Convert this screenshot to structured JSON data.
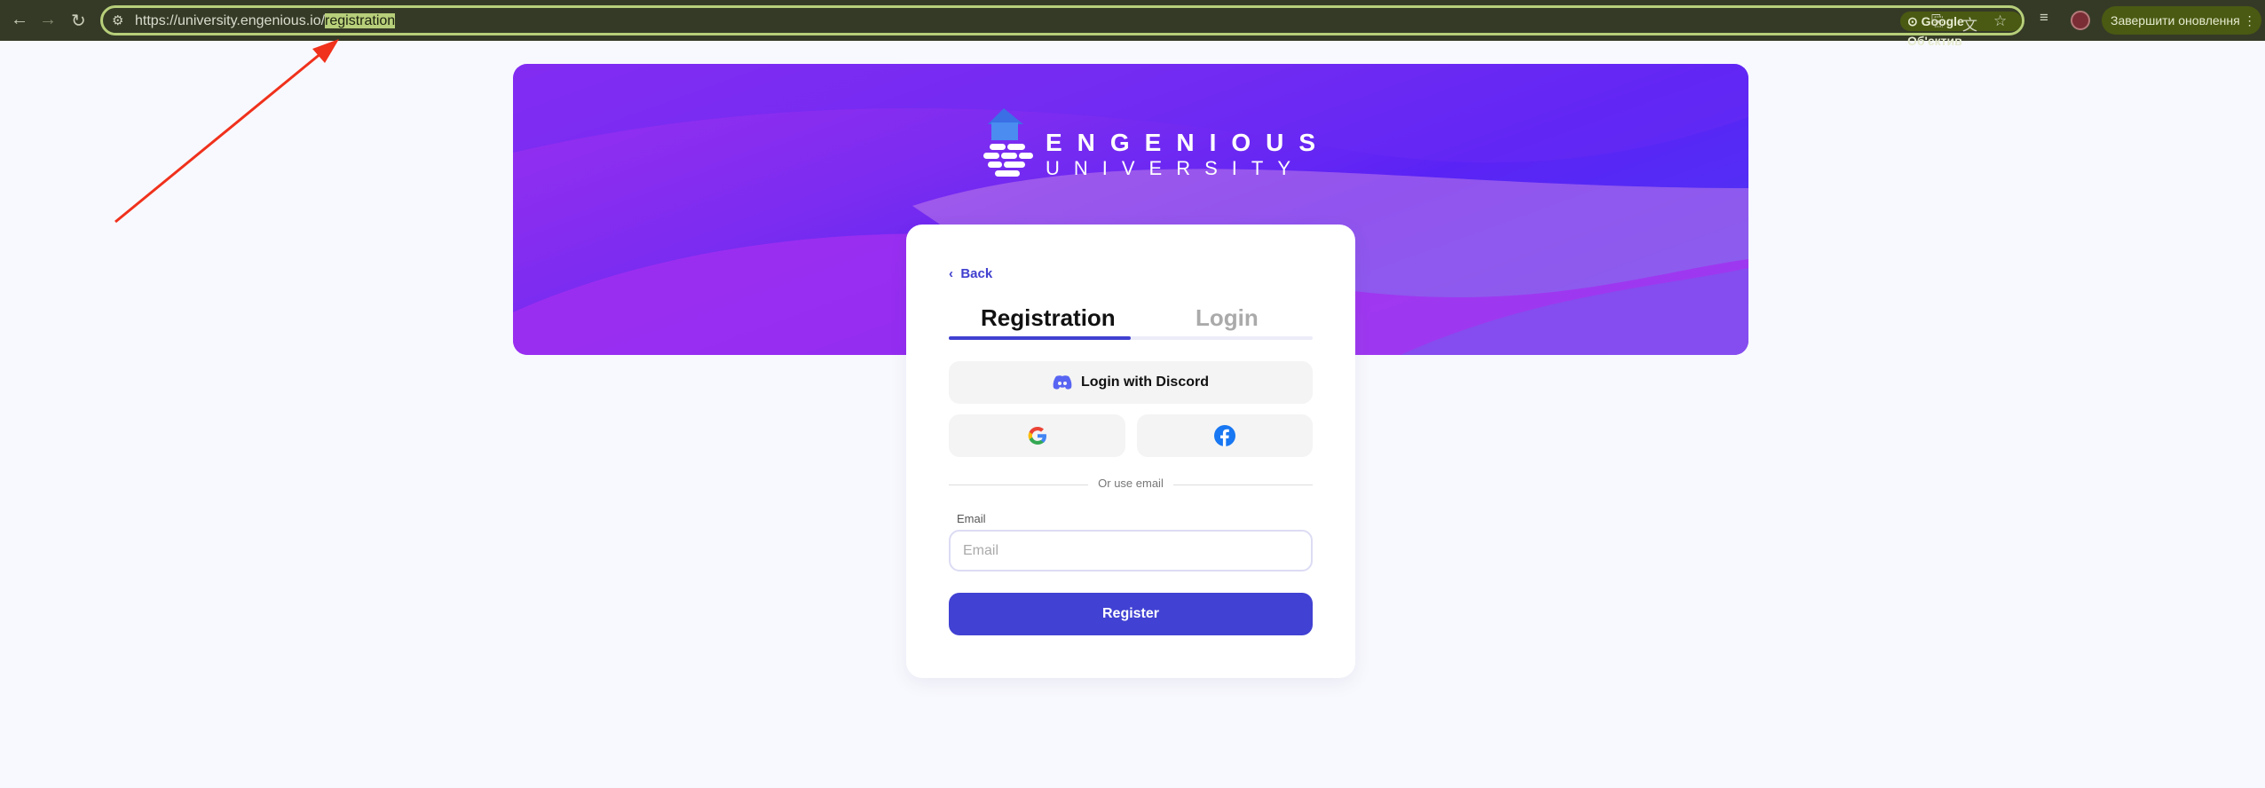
{
  "browser": {
    "url_base": "https://university.engenious.io/",
    "url_path": "registration",
    "lens_label": "Google Об'єктив",
    "update_label": "Завершити оновлення"
  },
  "banner": {
    "brand_line1": "ENGENIOUS",
    "brand_line2": "UNIVERSITY",
    "gradient_colors": [
      "#9c2ff0",
      "#5a23f5",
      "#4a3cf5"
    ]
  },
  "card": {
    "back_label": "Back",
    "tabs": [
      {
        "label": "Registration",
        "active": true
      },
      {
        "label": "Login",
        "active": false
      }
    ],
    "discord_label": "Login with Discord",
    "divider_text": "Or use email",
    "email": {
      "label": "Email",
      "placeholder": "Email",
      "value": ""
    },
    "register_label": "Register"
  },
  "colors": {
    "accent": "#4141d3",
    "discord": "#5865f2",
    "facebook": "#1877f2",
    "annotation_arrow": "#f0311c"
  }
}
